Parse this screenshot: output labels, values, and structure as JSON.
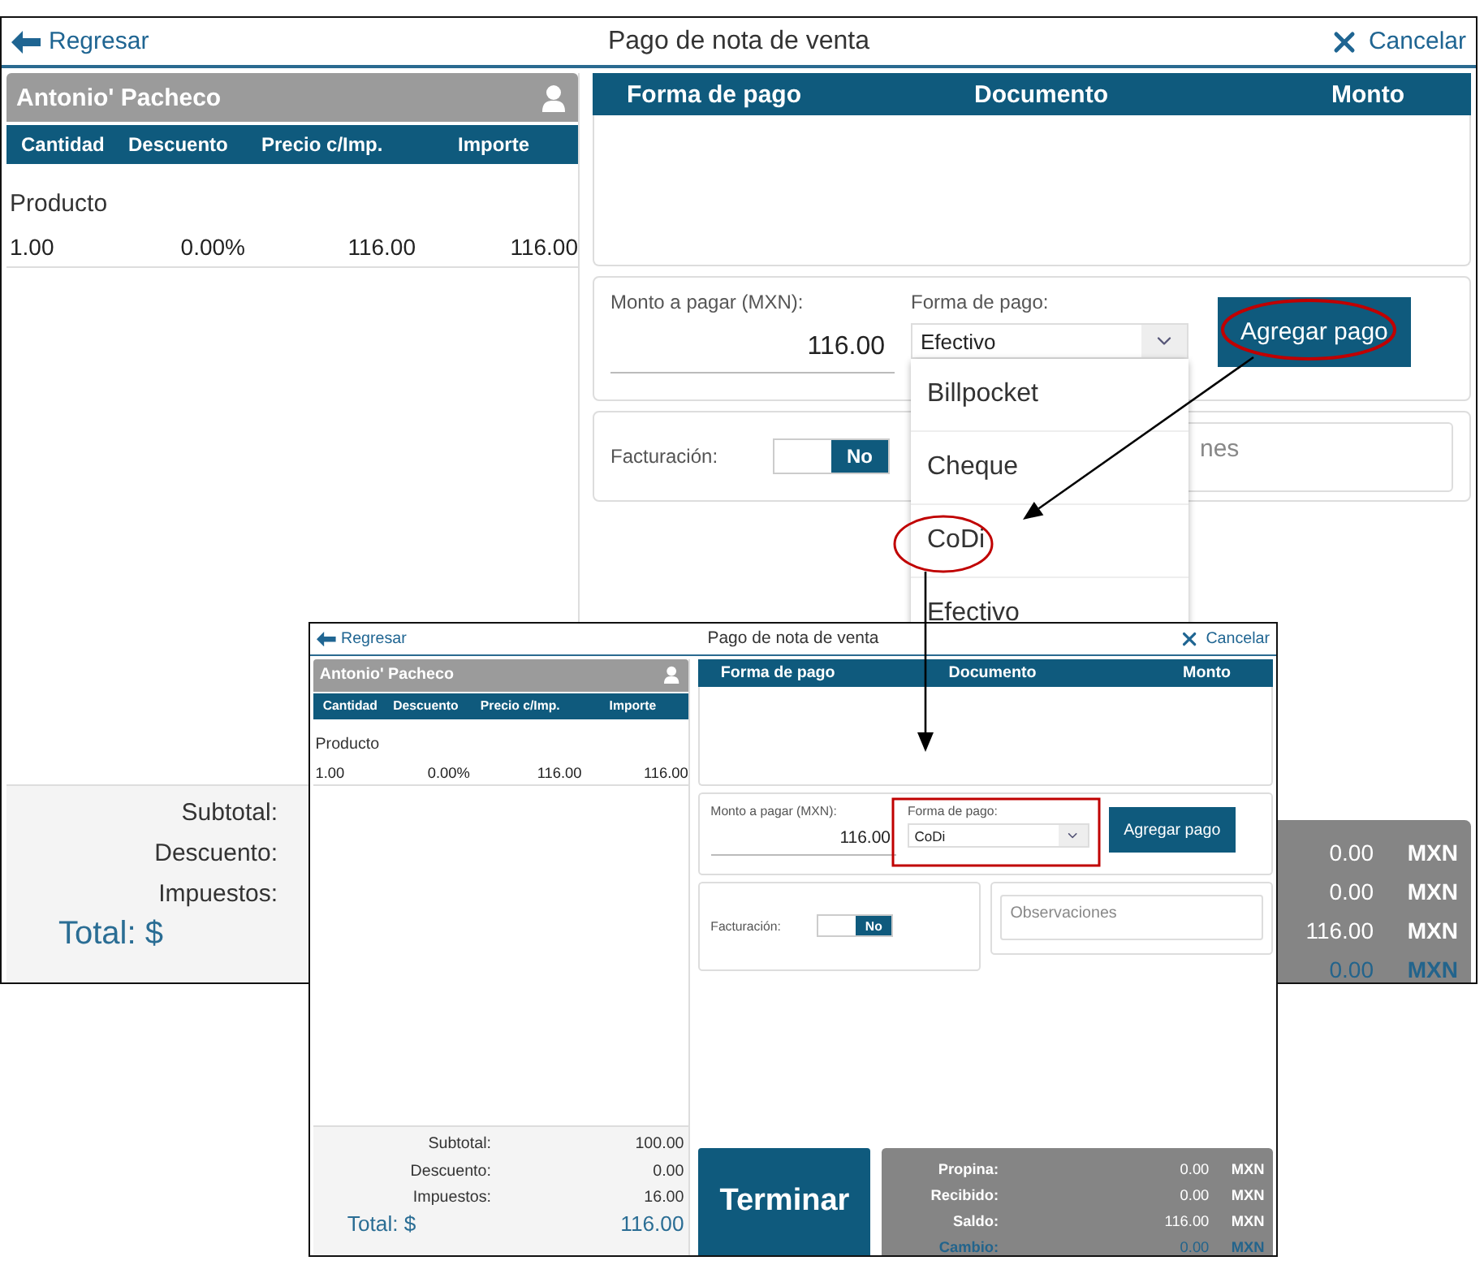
{
  "main_screen": {
    "top_bar": {
      "back": "Regresar",
      "title": "Pago de nota de venta",
      "cancel": "Cancelar"
    },
    "customer": "Antonio' Pacheco",
    "item_columns": [
      "Cantidad",
      "Descuento",
      "Precio c/Imp.",
      "Importe"
    ],
    "items": [
      {
        "name": "Producto",
        "cells": [
          "1.00",
          "0.00%",
          "116.00",
          "116.00"
        ]
      }
    ],
    "payment_columns": [
      "Forma de pago",
      "Documento",
      "Monto"
    ],
    "amount_label": "Monto a pagar (MXN):",
    "amount": "116.00",
    "method_label": "Forma de pago:",
    "method": "Efectivo",
    "method_options": [
      "Billpocket",
      "Cheque",
      "CoDi",
      "Efectivo"
    ],
    "add_button": "Agregar pago",
    "invoice_label": "Facturación:",
    "invoice_toggle": {
      "label": "No",
      "on": false
    },
    "notes": {
      "placeholder": "nes"
    },
    "summary": [
      {
        "label": "Subtotal:"
      },
      {
        "label": "Descuento:"
      },
      {
        "label": "Impuestos:"
      }
    ],
    "total": {
      "label": "Total: $"
    },
    "balance": [
      {
        "kind": "amount",
        "value": "0.00",
        "currency": "MXN"
      },
      {
        "kind": "amount",
        "value": "0.00",
        "currency": "MXN"
      },
      {
        "kind": "amount",
        "value": "116.00",
        "currency": "MXN"
      },
      {
        "kind": "change",
        "value": "0.00",
        "currency": "MXN"
      }
    ]
  },
  "overlay_screen": {
    "top_bar": {
      "back": "Regresar",
      "title": "Pago de nota de venta",
      "cancel": "Cancelar"
    },
    "customer": "Antonio' Pacheco",
    "item_columns": [
      "Cantidad",
      "Descuento",
      "Precio c/Imp.",
      "Importe"
    ],
    "items": [
      {
        "name": "Producto",
        "cells": [
          "1.00",
          "0.00%",
          "116.00",
          "116.00"
        ]
      }
    ],
    "payment_columns": [
      "Forma de pago",
      "Documento",
      "Monto"
    ],
    "amount_label": "Monto a pagar (MXN):",
    "amount": "116.00",
    "method_label": "Forma de pago:",
    "method": "CoDi",
    "add_button": "Agregar pago",
    "invoice_label": "Facturación:",
    "invoice_toggle": {
      "label": "No",
      "on": false
    },
    "notes": {
      "placeholder": "Observaciones"
    },
    "summary": [
      {
        "label": "Subtotal:",
        "value": "100.00"
      },
      {
        "label": "Descuento:",
        "value": "0.00"
      },
      {
        "label": "Impuestos:",
        "value": "16.00"
      }
    ],
    "total": {
      "label": "Total: $",
      "value": "116.00"
    },
    "finish_button": "Terminar",
    "balance": [
      {
        "kind": "amount",
        "label": "Propina:",
        "value": "0.00",
        "currency": "MXN"
      },
      {
        "kind": "amount",
        "label": "Recibido:",
        "value": "0.00",
        "currency": "MXN"
      },
      {
        "kind": "amount",
        "label": "Saldo:",
        "value": "116.00",
        "currency": "MXN"
      },
      {
        "kind": "change",
        "label": "Cambio:",
        "value": "0.00",
        "currency": "MXN"
      }
    ]
  }
}
